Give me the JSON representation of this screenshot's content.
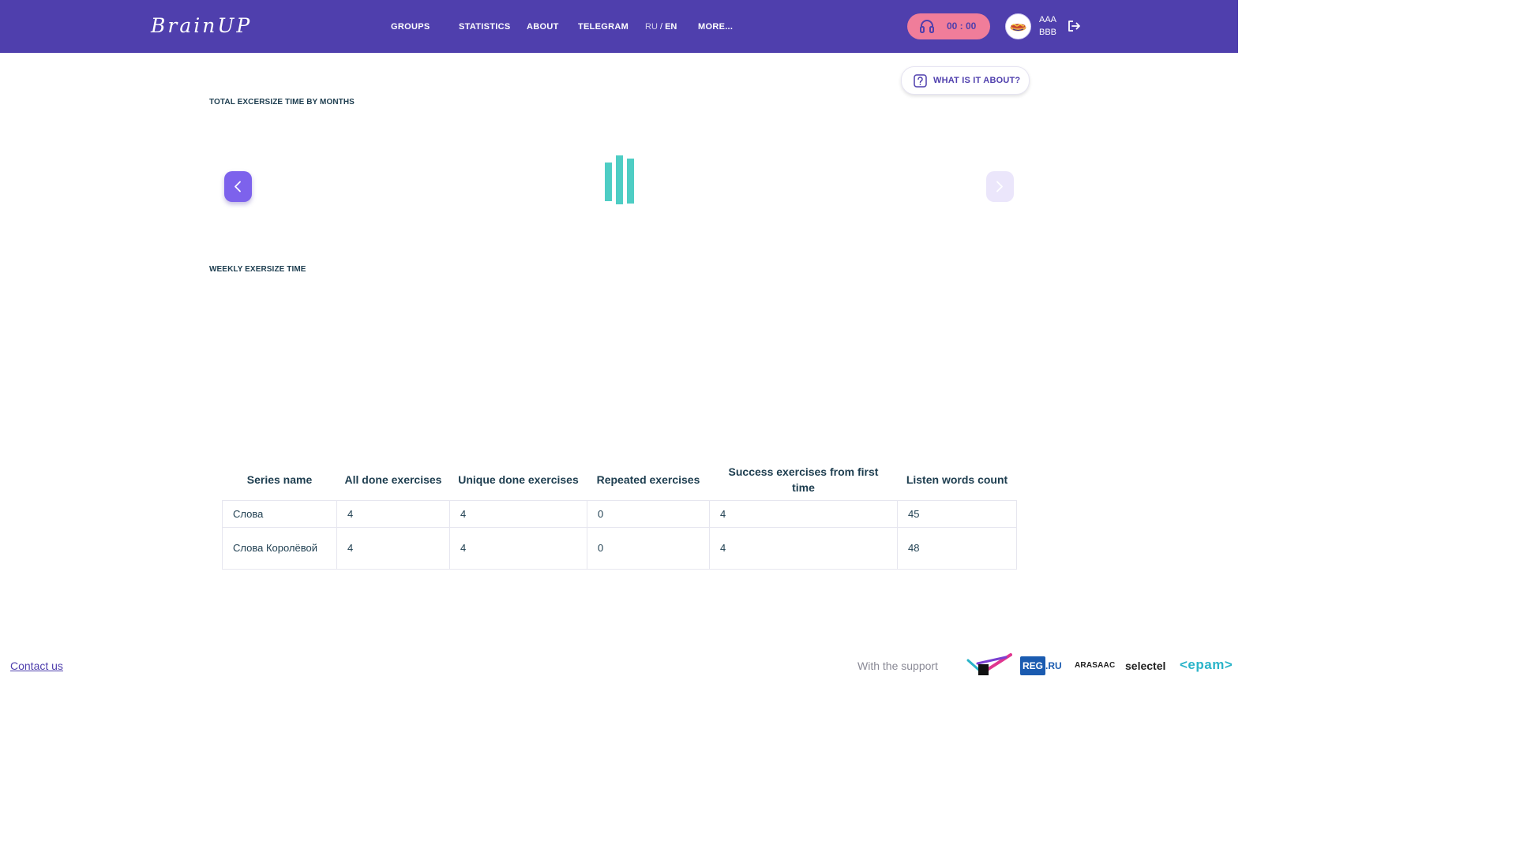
{
  "header": {
    "logo": "BrainUP",
    "nav": {
      "groups": "GROUPS",
      "statistics": "STATISTICS",
      "about": "ABOUT",
      "telegram": "TELEGRAM",
      "more": "MORE..."
    },
    "lang": {
      "ru": "RU",
      "sep": " / ",
      "en": "EN"
    },
    "timer": "00 : 00",
    "user": {
      "first": "AAA",
      "second": "BBB"
    }
  },
  "help_button": "WHAT IS IT ABOUT?",
  "monthly_section": {
    "title": "TOTAL EXCERSIZE TIME BY MONTHS"
  },
  "weekly_section": {
    "title": "WEEKLY EXERSIZE TIME"
  },
  "table": {
    "headers": [
      "Series name",
      "All done exercises",
      "Unique done exercises",
      "Repeated exercises",
      "Success exercises from first time",
      "Listen words count"
    ],
    "rows": [
      [
        "Слова",
        "4",
        "4",
        "0",
        "4",
        "45"
      ],
      [
        "Слова Королёвой",
        "4",
        "4",
        "0",
        "4",
        "48"
      ]
    ]
  },
  "footer": {
    "contact": "Contact us",
    "support": "With the support",
    "partners": [
      "REG.RU",
      "ARASAAC",
      "selectel",
      "<epam>"
    ]
  },
  "colors": {
    "header_bg": "#4f3fad",
    "accent_pink": "#f07d9a",
    "loader_teal": "#4ecdc4",
    "arrow_active": "#7d62ec"
  }
}
